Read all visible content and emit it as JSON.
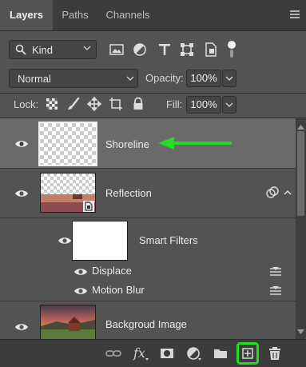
{
  "tabs": [
    {
      "label": "Layers",
      "active": true
    },
    {
      "label": "Paths",
      "active": false
    },
    {
      "label": "Channels",
      "active": false
    }
  ],
  "filter": {
    "kind_label": "Kind"
  },
  "blend": {
    "mode": "Normal",
    "opacity_label": "Opacity:",
    "opacity_value": "100%"
  },
  "lock": {
    "label": "Lock:",
    "fill_label": "Fill:",
    "fill_value": "100%"
  },
  "layers": {
    "shoreline": "Shoreline",
    "reflection": "Reflection",
    "smart_filters": "Smart Filters",
    "displace": "Displace",
    "motion_blur": "Motion Blur",
    "background": "Backgroud Image"
  },
  "colors": {
    "accent_green": "#22dd22",
    "panel": "#535353",
    "selected": "#6a6a6a"
  },
  "bottom_icons": [
    "link-layers-icon",
    "fx-icon",
    "add-mask-icon",
    "adjustment-layer-icon",
    "new-group-icon",
    "new-layer-icon",
    "delete-icon"
  ],
  "fx_label": "fx"
}
